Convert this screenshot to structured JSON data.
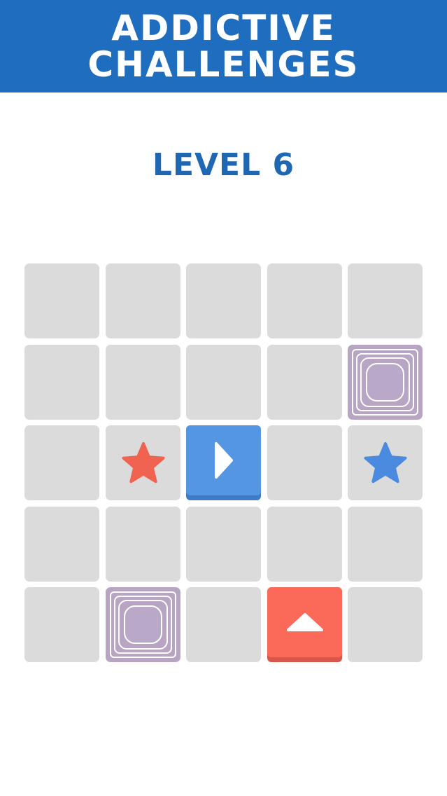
{
  "banner": {
    "line1": "ADDICTIVE",
    "line2": "CHALLENGES",
    "color": "#1f6dbf"
  },
  "level": {
    "label": "LEVEL 6",
    "color": "#2067b3"
  },
  "board": {
    "rows": 5,
    "cols": 5,
    "empty_cell_color": "#dbdbdb",
    "portals": [
      {
        "row": 1,
        "col": 4,
        "icon": "portal-square-icon"
      },
      {
        "row": 4,
        "col": 1,
        "icon": "portal-square-icon"
      }
    ],
    "stars": [
      {
        "row": 2,
        "col": 1,
        "color": "#f06350",
        "icon": "star-icon"
      },
      {
        "row": 2,
        "col": 4,
        "color": "#4a8be0",
        "icon": "star-icon"
      }
    ],
    "blocks": [
      {
        "row": 2,
        "col": 2,
        "color": "#5596e3",
        "direction": "right",
        "icon": "arrow-right-icon"
      },
      {
        "row": 4,
        "col": 3,
        "color": "#fb6a59",
        "direction": "up",
        "icon": "arrow-up-icon"
      }
    ]
  }
}
